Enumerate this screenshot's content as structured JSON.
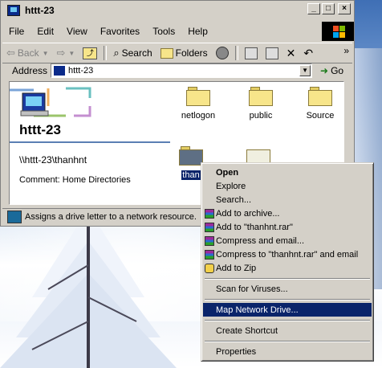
{
  "window": {
    "title": "httt-23",
    "controls": {
      "minimize": "_",
      "maximize": "□",
      "close": "×"
    }
  },
  "menubar": [
    "File",
    "Edit",
    "View",
    "Favorites",
    "Tools",
    "Help"
  ],
  "toolbar": {
    "back": "Back",
    "search": "Search",
    "folders": "Folders",
    "more": "»"
  },
  "address": {
    "label": "Address",
    "value": "httt-23",
    "go": "Go"
  },
  "content": {
    "title": "httt-23",
    "unc_path": "\\\\httt-23\\thanhnt",
    "comment": "Comment: Home Directories",
    "folders": [
      {
        "label": "netlogon"
      },
      {
        "label": "public"
      },
      {
        "label": "Source"
      },
      {
        "label": "than"
      }
    ]
  },
  "status": {
    "text": "Assigns a drive letter to a network resource."
  },
  "context_menu": {
    "items": [
      {
        "label": "Open",
        "bold": true
      },
      {
        "label": "Explore"
      },
      {
        "label": "Search..."
      },
      {
        "label": "Add to archive...",
        "icon": "winrar-icon"
      },
      {
        "label": "Add to \"thanhnt.rar\"",
        "icon": "winrar-icon"
      },
      {
        "label": "Compress and email...",
        "icon": "winrar-icon"
      },
      {
        "label": "Compress to \"thanhnt.rar\" and email",
        "icon": "winrar-icon"
      },
      {
        "label": "Add to Zip",
        "icon": "zip-icon"
      },
      {
        "label": "Scan for Viruses..."
      },
      {
        "label": "Map Network Drive...",
        "highlighted": true
      },
      {
        "label": "Create Shortcut"
      },
      {
        "label": "Properties"
      }
    ]
  },
  "colors": {
    "selection": "#0a246a",
    "window_face": "#d4d0c8",
    "folder_yellow": "#f7e58a"
  }
}
